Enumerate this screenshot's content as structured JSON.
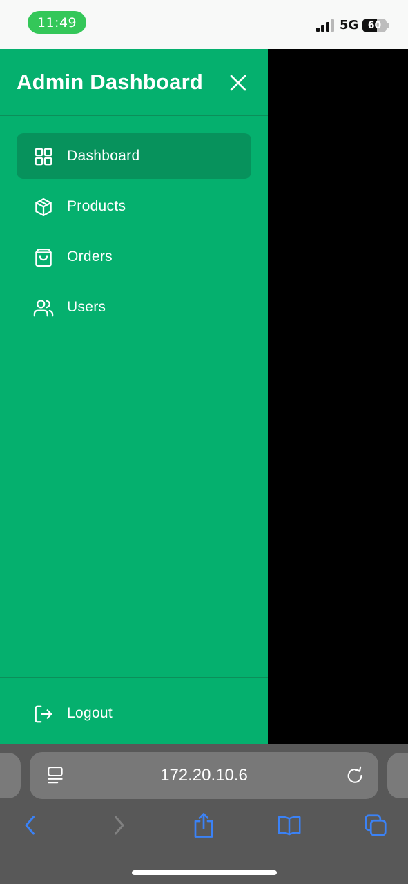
{
  "status_bar": {
    "time": "11:49",
    "network": "5G",
    "battery": "60",
    "battery_level": 0.6
  },
  "sidebar": {
    "title": "Admin Dashboard",
    "items": [
      {
        "label": "Dashboard",
        "icon": "grid-icon",
        "active": true
      },
      {
        "label": "Products",
        "icon": "box-icon",
        "active": false
      },
      {
        "label": "Orders",
        "icon": "shopping-bag-icon",
        "active": false
      },
      {
        "label": "Users",
        "icon": "users-icon",
        "active": false
      }
    ],
    "logout_label": "Logout"
  },
  "browser": {
    "url": "172.20.10.6"
  },
  "colors": {
    "sidebar_bg": "#05b06e",
    "active_item_bg": "#07925c",
    "time_pill": "#34c759",
    "toolbar_icon": "#3b82f6"
  }
}
